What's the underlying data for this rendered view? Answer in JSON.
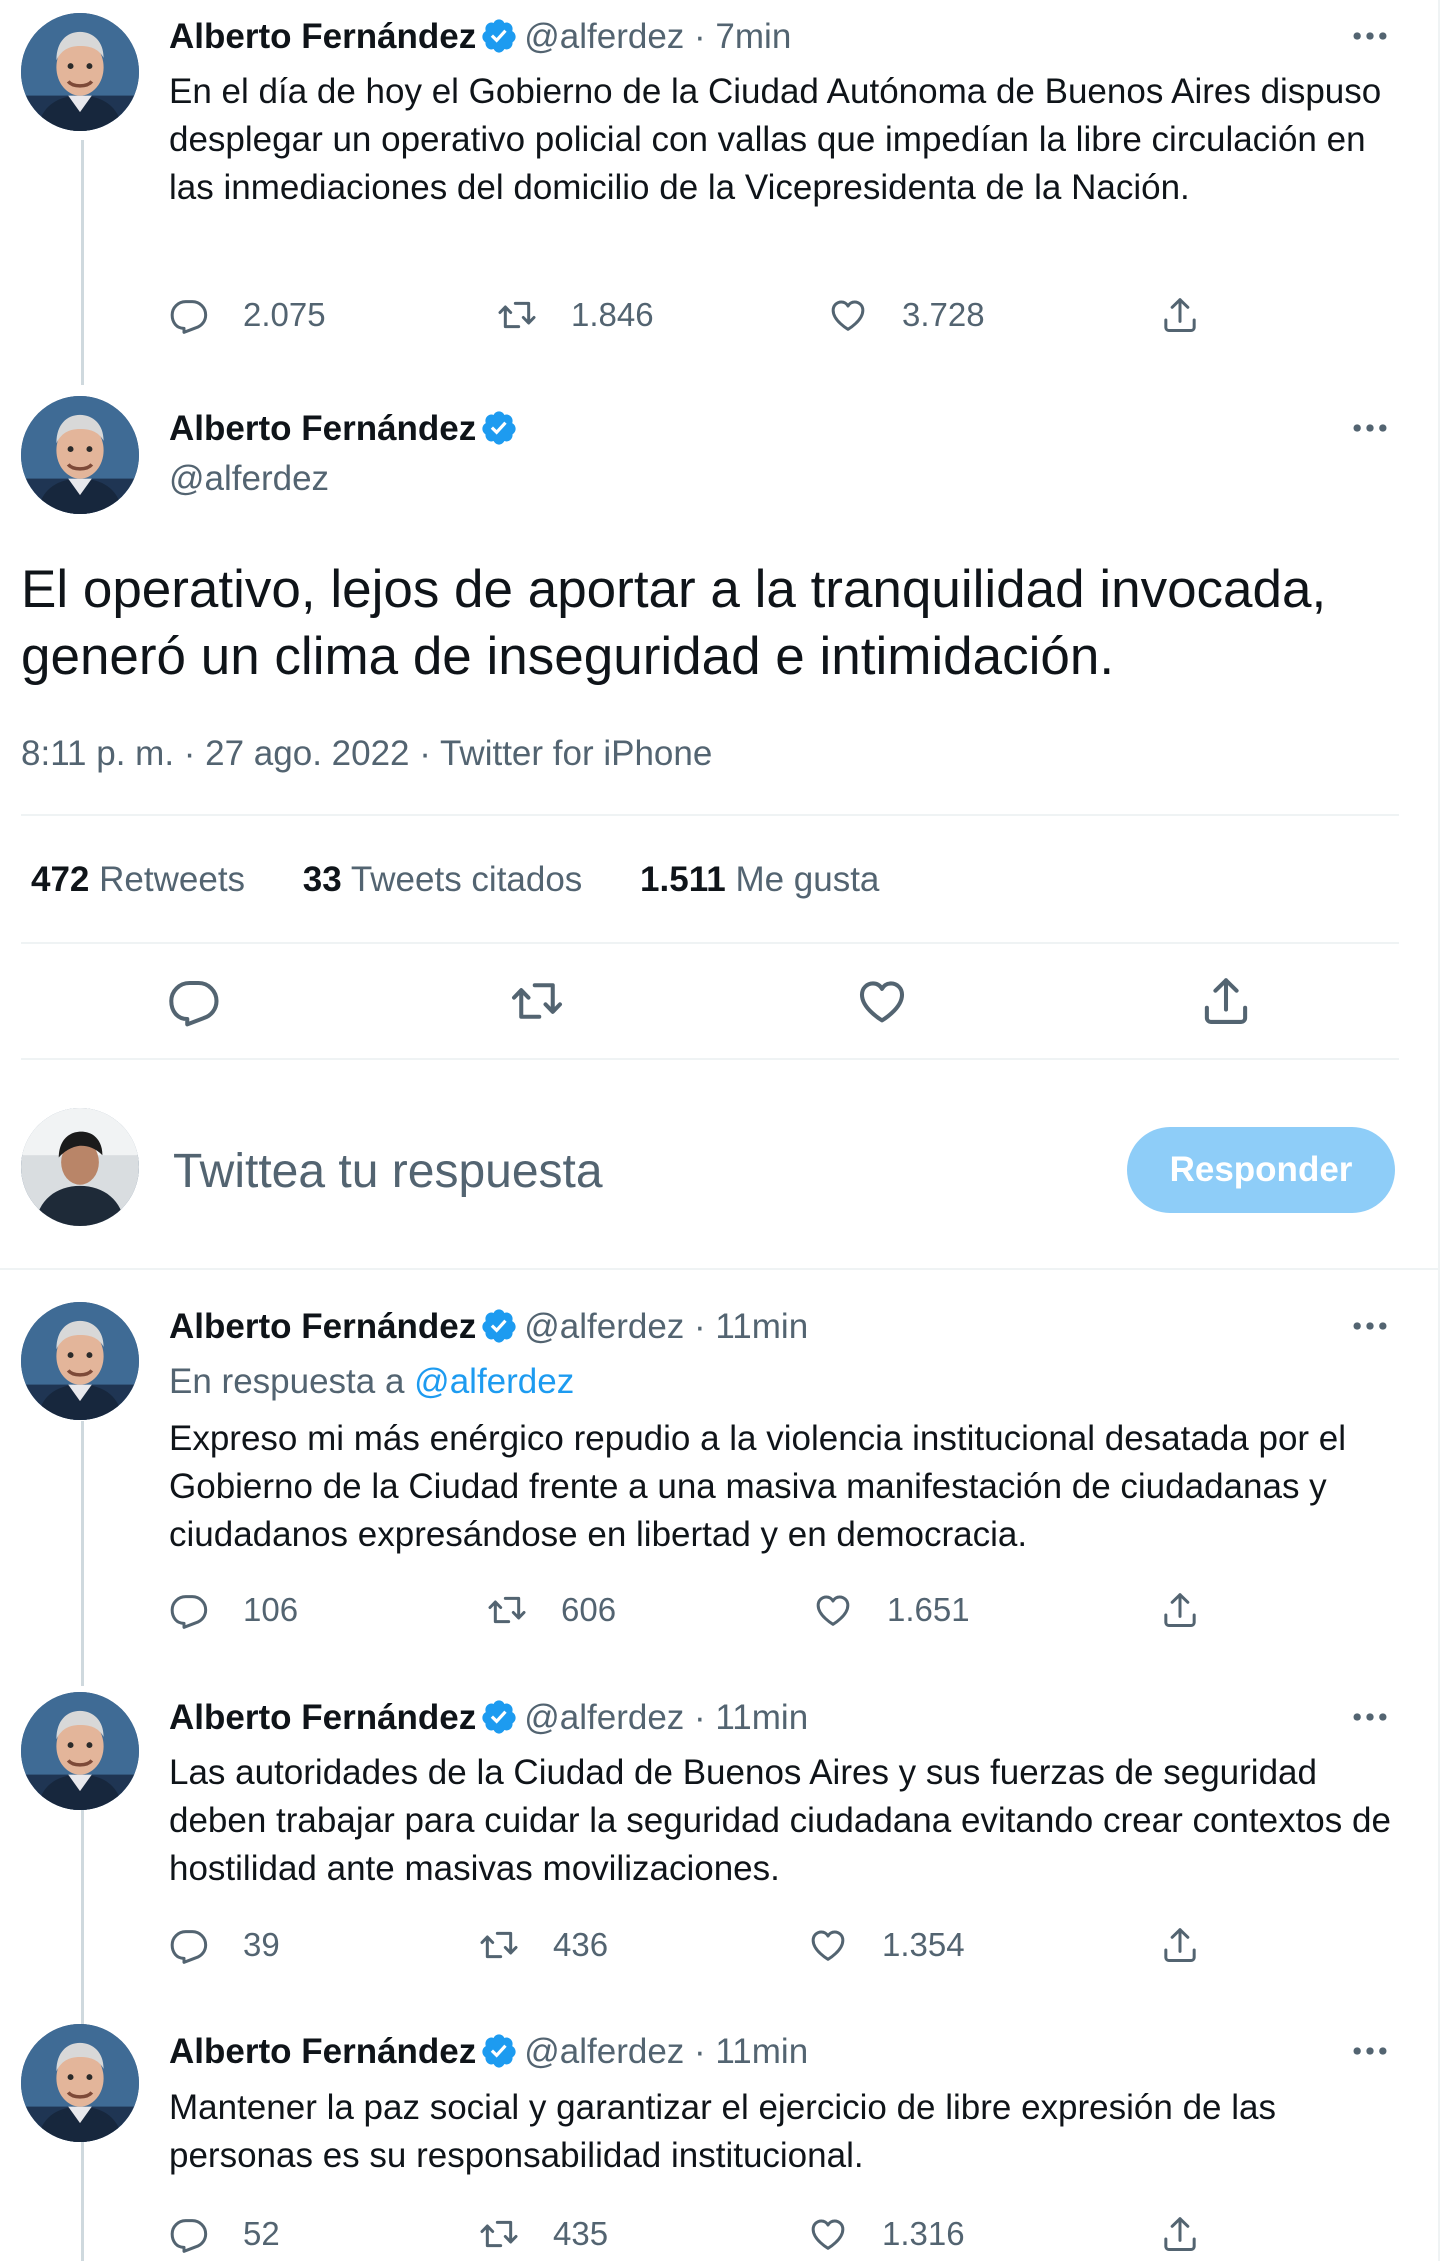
{
  "colors": {
    "text": "#0f1419",
    "secondary": "#536471",
    "accent": "#1d9bf0",
    "reply_button_disabled": "#8ecdf8",
    "divider": "#eff3f4"
  },
  "icons": {
    "verified": "verified-badge-icon",
    "more": "more-options-icon",
    "reply": "reply-icon",
    "retweet": "retweet-icon",
    "like": "like-icon",
    "share": "share-icon"
  },
  "tweets": [
    {
      "author": "Alberto Fernández",
      "handle": "@alferdez",
      "time": "· 7min",
      "text": "En el día de hoy el Gobierno de la Ciudad Autónoma de Buenos Aires dispuso desplegar un operativo policial con vallas que impedían la libre circulación en las inmediaciones del domicilio de la Vicepresidenta de la Nación.",
      "replies": "2.075",
      "retweets": "1.846",
      "likes": "3.728"
    }
  ],
  "main_tweet": {
    "author": "Alberto Fernández",
    "handle": "@alferdez",
    "text": "El operativo, lejos de aportar a la tranquilidad invocada, generó un clima de inseguridad e intimidación.",
    "timestamp": "8:11 p. m. · 27 ago. 2022 · Twitter for iPhone",
    "stats": {
      "retweets_count": "472",
      "retweets_label": "Retweets",
      "quotes_count": "33",
      "quotes_label": "Tweets citados",
      "likes_count": "1.511",
      "likes_label": "Me gusta"
    }
  },
  "reply_box": {
    "placeholder": "Twittea tu respuesta",
    "button_label": "Responder"
  },
  "replies": [
    {
      "author": "Alberto Fernández",
      "handle": "@alferdez",
      "time": "· 11min",
      "reply_prefix": "En respuesta a",
      "reply_to": "@alferdez",
      "text": "Expreso mi más enérgico repudio a la violencia institucional desatada por el Gobierno de la Ciudad frente a una masiva manifestación de ciudadanas y ciudadanos expresándose en libertad y en democracia.",
      "replies": "106",
      "retweets": "606",
      "likes": "1.651"
    },
    {
      "author": "Alberto Fernández",
      "handle": "@alferdez",
      "time": "· 11min",
      "text": "Las autoridades de la Ciudad de Buenos Aires y sus fuerzas de seguridad deben trabajar para cuidar la seguridad ciudadana evitando crear contextos de hostilidad ante masivas movilizaciones.",
      "replies": "39",
      "retweets": "436",
      "likes": "1.354"
    },
    {
      "author": "Alberto Fernández",
      "handle": "@alferdez",
      "time": "· 11min",
      "text": "Mantener la paz social y garantizar el ejercicio de libre expresión de las personas es su responsabilidad institucional.",
      "replies": "52",
      "retweets": "435",
      "likes": "1.316"
    }
  ]
}
